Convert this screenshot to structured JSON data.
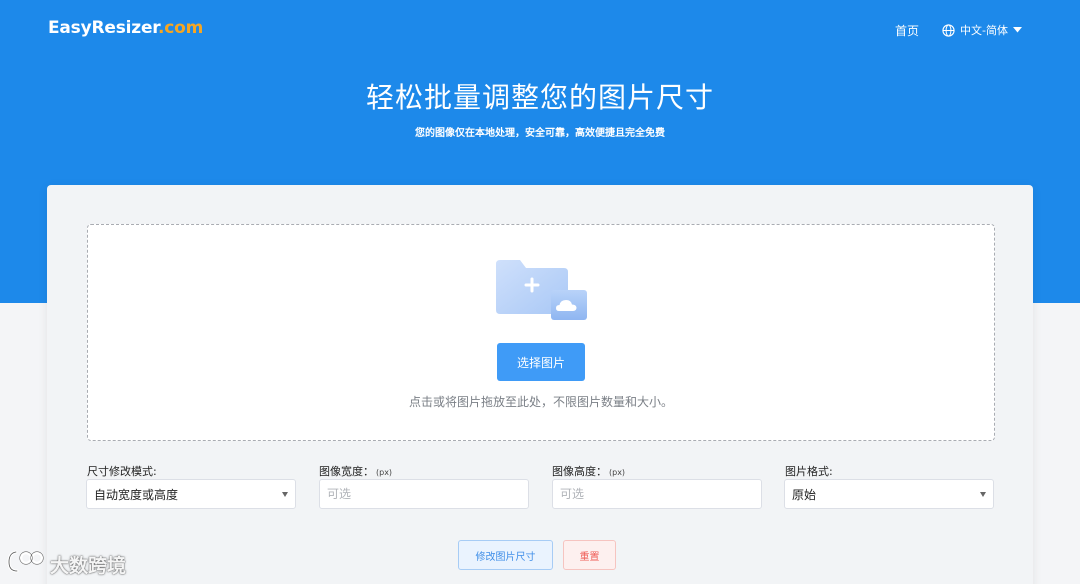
{
  "nav": {
    "logo_main": "EasyResizer",
    "logo_tld": ".com",
    "home": "首页",
    "language": "中文-简体"
  },
  "hero": {
    "title": "轻松批量调整您的图片尺寸",
    "subtitle": "您的图像仅在本地处理，安全可靠，高效便捷且完全免费"
  },
  "upload": {
    "button": "选择图片",
    "hint": "点击或将图片拖放至此处，不限图片数量和大小。"
  },
  "settings": {
    "mode": {
      "label": "尺寸修改模式:",
      "value": "自动宽度或高度"
    },
    "width": {
      "label": "图像宽度：",
      "unit": "(px)",
      "placeholder": "可选"
    },
    "height": {
      "label": "图像高度：",
      "unit": "(px)",
      "placeholder": "可选"
    },
    "format": {
      "label": "图片格式:",
      "value": "原始"
    }
  },
  "actions": {
    "resize": "修改图片尺寸",
    "reset": "重置"
  },
  "watermark": {
    "text": "大数跨境"
  },
  "colors": {
    "brand_blue": "#1d89ea",
    "logo_accent": "#f5a623",
    "primary_button": "#3f9bf7",
    "danger_text": "#f0605a"
  },
  "icons": {
    "language": "globe-icon",
    "dropdown": "caret-down-icon",
    "upload": "folder-cloud-icon"
  }
}
